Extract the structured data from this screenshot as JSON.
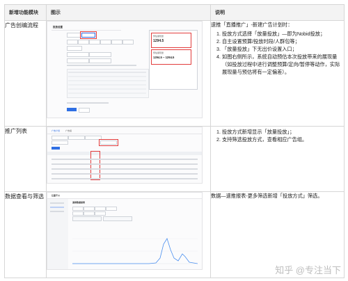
{
  "table": {
    "headers": [
      "新增功能模块",
      "图示",
      "说明"
    ]
  },
  "rows": [
    {
      "name": "广告创编流程",
      "desc_intro": "速推「直播推广」-新建广告计划时：",
      "desc_items": [
        "投放方式选择「放量投放」—即为Nobid投放；",
        "自主设置预算/投放时段/人群包等；",
        "「放量投放」下无出价设置入口；",
        "如图右侧所示，系统自动预估本次投放带来的展现量（如投放过程中进行调整预算/定向/暂停等动作，实际展现量与预估将有一定偏差）。"
      ],
      "shot": {
        "title": "投放设置",
        "estimate_label": "预估展现量",
        "estimate_a": "1294.5",
        "estimate_range": "1294.5 ~ 1294.5"
      }
    },
    {
      "name": "推广列表",
      "desc_items": [
        "投放方式新增显示「放量投放」；",
        "支持筛选投放方式，查看相应广告组。"
      ],
      "shot": {
        "tab_a": "广告计划",
        "tab_b": "广告组"
      }
    },
    {
      "name": "数据查看与筛选",
      "desc_text": "数据—速推报表-更多筛选新增「投放方式」筛选。",
      "shot": {
        "brand": "巨量千川",
        "page_title": "速推数据报表"
      }
    }
  ],
  "watermark": "知乎 @专注当下"
}
